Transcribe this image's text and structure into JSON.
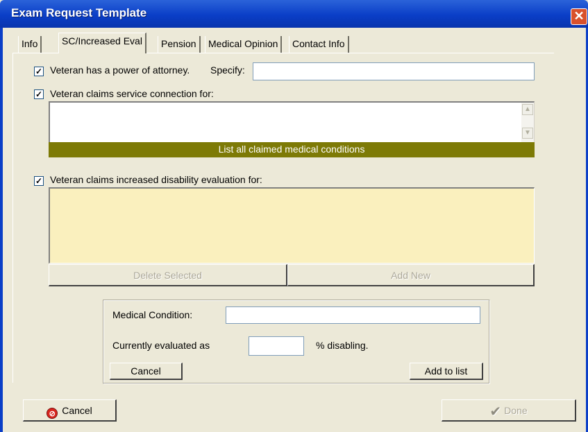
{
  "window": {
    "title": "Exam Request Template",
    "close_glyph": "✕"
  },
  "tabs": [
    {
      "label": "Info"
    },
    {
      "label": "SC/Increased Eval",
      "active": true
    },
    {
      "label": "Pension"
    },
    {
      "label": "Medical Opinion"
    },
    {
      "label": "Contact Info"
    }
  ],
  "poa": {
    "checked": true,
    "label": "Veteran has a power of attorney.",
    "specify_label": "Specify:",
    "specify_value": ""
  },
  "service_connection": {
    "checked": true,
    "label": "Veteran claims service connection for:",
    "value": "",
    "hint": "List all claimed medical conditions"
  },
  "increased_eval": {
    "checked": true,
    "label": "Veteran claims increased disability evaluation for:"
  },
  "list_buttons": {
    "delete_label": "Delete Selected",
    "add_new_label": "Add New"
  },
  "condition_form": {
    "condition_label": "Medical Condition:",
    "condition_value": "",
    "evaluated_label": "Currently evaluated as",
    "percent_value": "",
    "percent_suffix": "% disabling.",
    "cancel_label": "Cancel",
    "add_label": "Add to list"
  },
  "footer": {
    "cancel_label": "Cancel",
    "cancel_icon": "no-entry-icon",
    "done_label": "Done",
    "done_icon": "checkmark-icon"
  },
  "colors": {
    "title_bar": "#0A3EC7",
    "olive_hint_bar": "#7D7A06",
    "yellow_list": "#FAF0BE",
    "close_button": "#D9512C"
  }
}
